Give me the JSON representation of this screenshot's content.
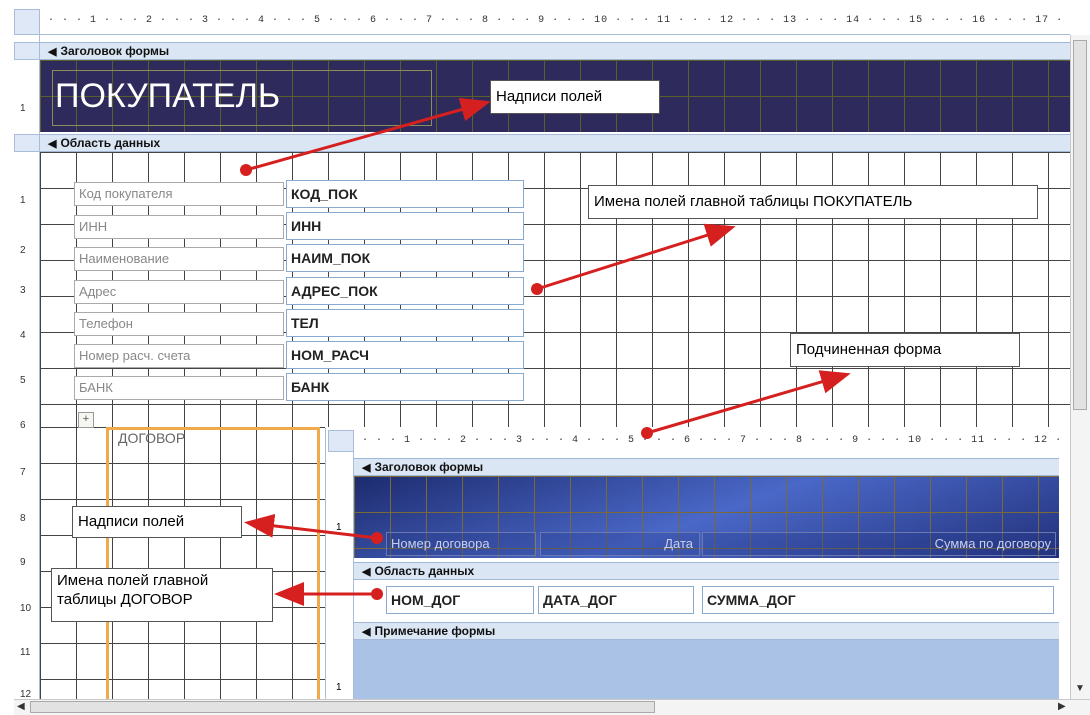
{
  "ruler": {
    "top": "· · · 1 · · · 2 · · · 3 · · · 4 · · · 5 · · · 6 · · · 7 · · · 8 · · · 9 · · · 10 · · · 11 · · · 12 · · · 13 · · · 14 · · · 15 · · · 16 · · · 17 · · · 18 · ·",
    "sub_top": "· · · 1 · · · 2 · · · 3 · · · 4 · · · 5 · · · 6 · · · 7 · · · 8 · · · 9 · · · 10 · · · 11 · · · 12 · · 1",
    "left_numbers": [
      "1",
      "2",
      "3",
      "4",
      "5",
      "6",
      "7",
      "8",
      "9",
      "10",
      "11",
      "12"
    ],
    "sub_left_numbers": [
      "1",
      "1"
    ]
  },
  "sections": {
    "header_label": "Заголовок формы",
    "detail_label": "Область данных",
    "sub_header_label": "Заголовок формы",
    "sub_detail_label": "Область данных",
    "sub_footer_label": "Примечание формы"
  },
  "form": {
    "title": "ПОКУПАТЕЛЬ",
    "labels": [
      "Код покупателя",
      "ИНН",
      "Наименование",
      "Адрес",
      "Телефон",
      "Номер расч. счета",
      "БАНК"
    ],
    "fields": [
      "КОД_ПОК",
      "ИНН",
      "НАИМ_ПОК",
      "АДРЕС_ПОК",
      "ТЕЛ",
      "НОМ_РАСЧ",
      "БАНК"
    ],
    "subform_label": "ДОГОВОР"
  },
  "subform": {
    "labels": [
      "Номер договора",
      "Дата",
      "Сумма по договору"
    ],
    "fields": [
      "НОМ_ДОГ",
      "ДАТА_ДОГ",
      "СУММА_ДОГ"
    ]
  },
  "annotations": {
    "labels_top": "Надписи полей",
    "main_fields": "Имена полей главной таблицы ПОКУПАТЕЛЬ",
    "subform": "Подчиненная форма",
    "labels_sub": "Надписи полей",
    "sub_fields_line1": "Имена полей главной",
    "sub_fields_line2": "таблицы ДОГОВОР"
  },
  "colors": {
    "header_bg": "#2f2a5c",
    "arrow": "#d62020",
    "subform_border": "#f0a94b",
    "section_bar": "#dbe6f5"
  }
}
